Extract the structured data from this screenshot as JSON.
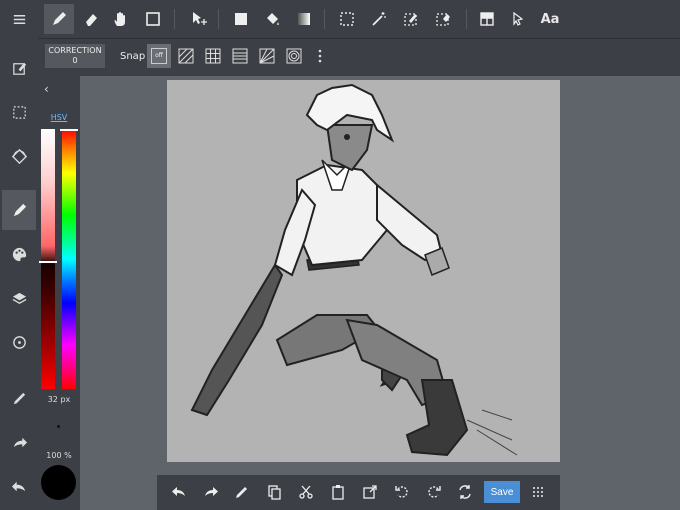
{
  "toolbar": {
    "text_tool": "Aa"
  },
  "subbar": {
    "correction_label": "CORRECTION",
    "correction_value": "0",
    "snap_label": "Snap",
    "snap_off": "off"
  },
  "color_panel": {
    "mode": "HSV",
    "brush_size": "32 px",
    "opacity": "100 %",
    "current_color": "#000000"
  },
  "bottom": {
    "save_label": "Save"
  },
  "colors": {
    "accent": "#4a8fd6",
    "toolbar_bg": "#3c3f45",
    "workspace_bg": "#5f636a",
    "canvas_bg": "#b3b3b3"
  }
}
